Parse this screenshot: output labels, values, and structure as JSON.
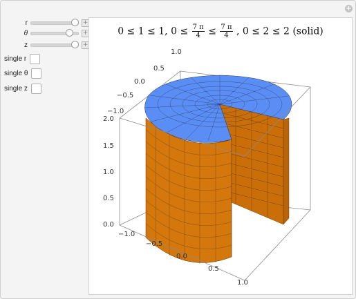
{
  "controls": {
    "sliders": [
      {
        "label": "r",
        "value_fraction": 0.97
      },
      {
        "label": "θ",
        "value_fraction": 0.83
      },
      {
        "label": "z",
        "value_fraction": 0.97
      }
    ],
    "stepper_symbol": "+",
    "checkboxes": [
      {
        "label": "single r",
        "checked": false
      },
      {
        "label": "single θ",
        "checked": false
      },
      {
        "label": "single z",
        "checked": false
      }
    ]
  },
  "plot": {
    "title_parts": {
      "a": "0 ≤ 1 ≤ 1, 0 ≤",
      "num1": "7 π",
      "den1": "4",
      "mid": "≤",
      "num2": "7 π",
      "den2": "4",
      "b": ", 0 ≤ 2 ≤ 2  (solid)"
    },
    "axis_ticks": {
      "z": [
        "0.0",
        "0.5",
        "1.0",
        "1.5",
        "2.0"
      ],
      "x_front": [
        "−1.0",
        "−0.5",
        "0.0",
        "0.5",
        "1.0"
      ],
      "y_top": [
        "−1.0",
        "−0.5",
        "0.0",
        "0.5",
        "1.0"
      ]
    },
    "colors": {
      "top_face": "#5b8ef5",
      "side_face": "#d4770c",
      "cut_face": "#c86d08"
    }
  },
  "corner_button": "+"
}
